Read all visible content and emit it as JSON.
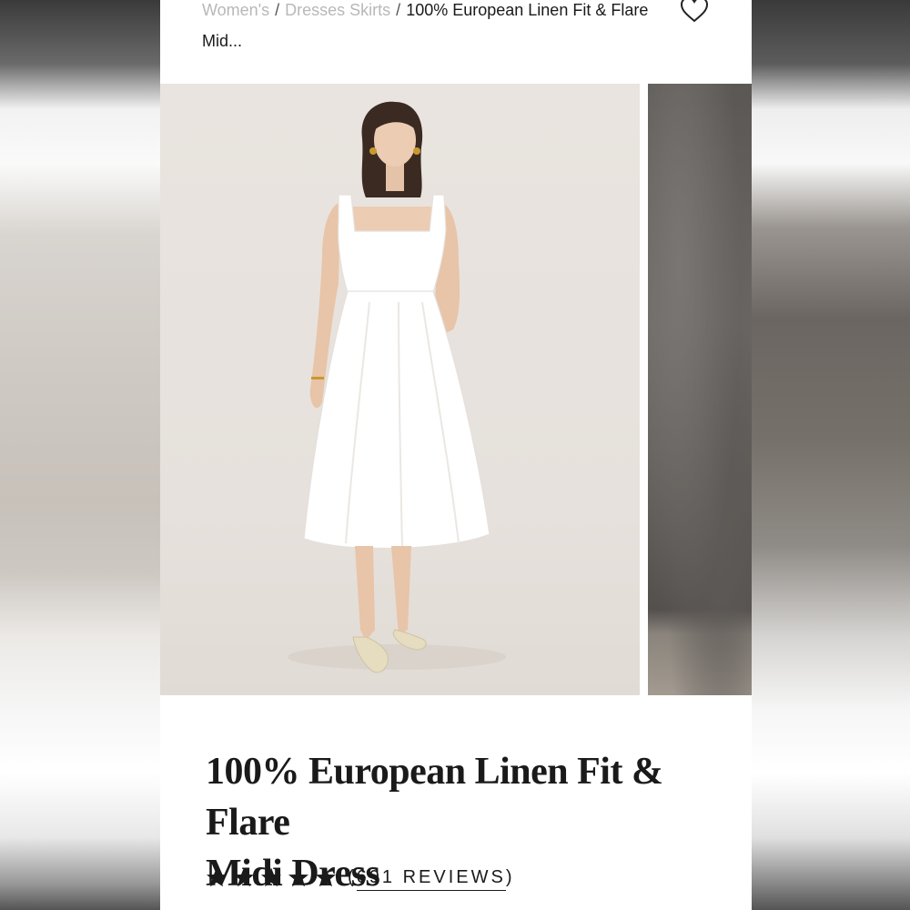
{
  "breadcrumb": {
    "items": [
      {
        "label": "Women's"
      },
      {
        "label": "Dresses Skirts"
      },
      {
        "label": "100% European Linen Fit & Flare Mid..."
      }
    ],
    "separator": "/"
  },
  "icons": {
    "wishlist": "heart-outline-icon",
    "rating_star": "star-filled-icon"
  },
  "product": {
    "title_line1": "100% European Linen Fit & Flare",
    "title_line2": "Midi Dress",
    "rating": 5,
    "reviews_open": "(",
    "reviews_label": "691 REVIEWS",
    "reviews_close": ")"
  },
  "colors": {
    "text": "#1a1a1a",
    "breadcrumb_link": "#b8b8b8",
    "photo_background": "#e7e2dd",
    "dress": "#ffffff"
  }
}
